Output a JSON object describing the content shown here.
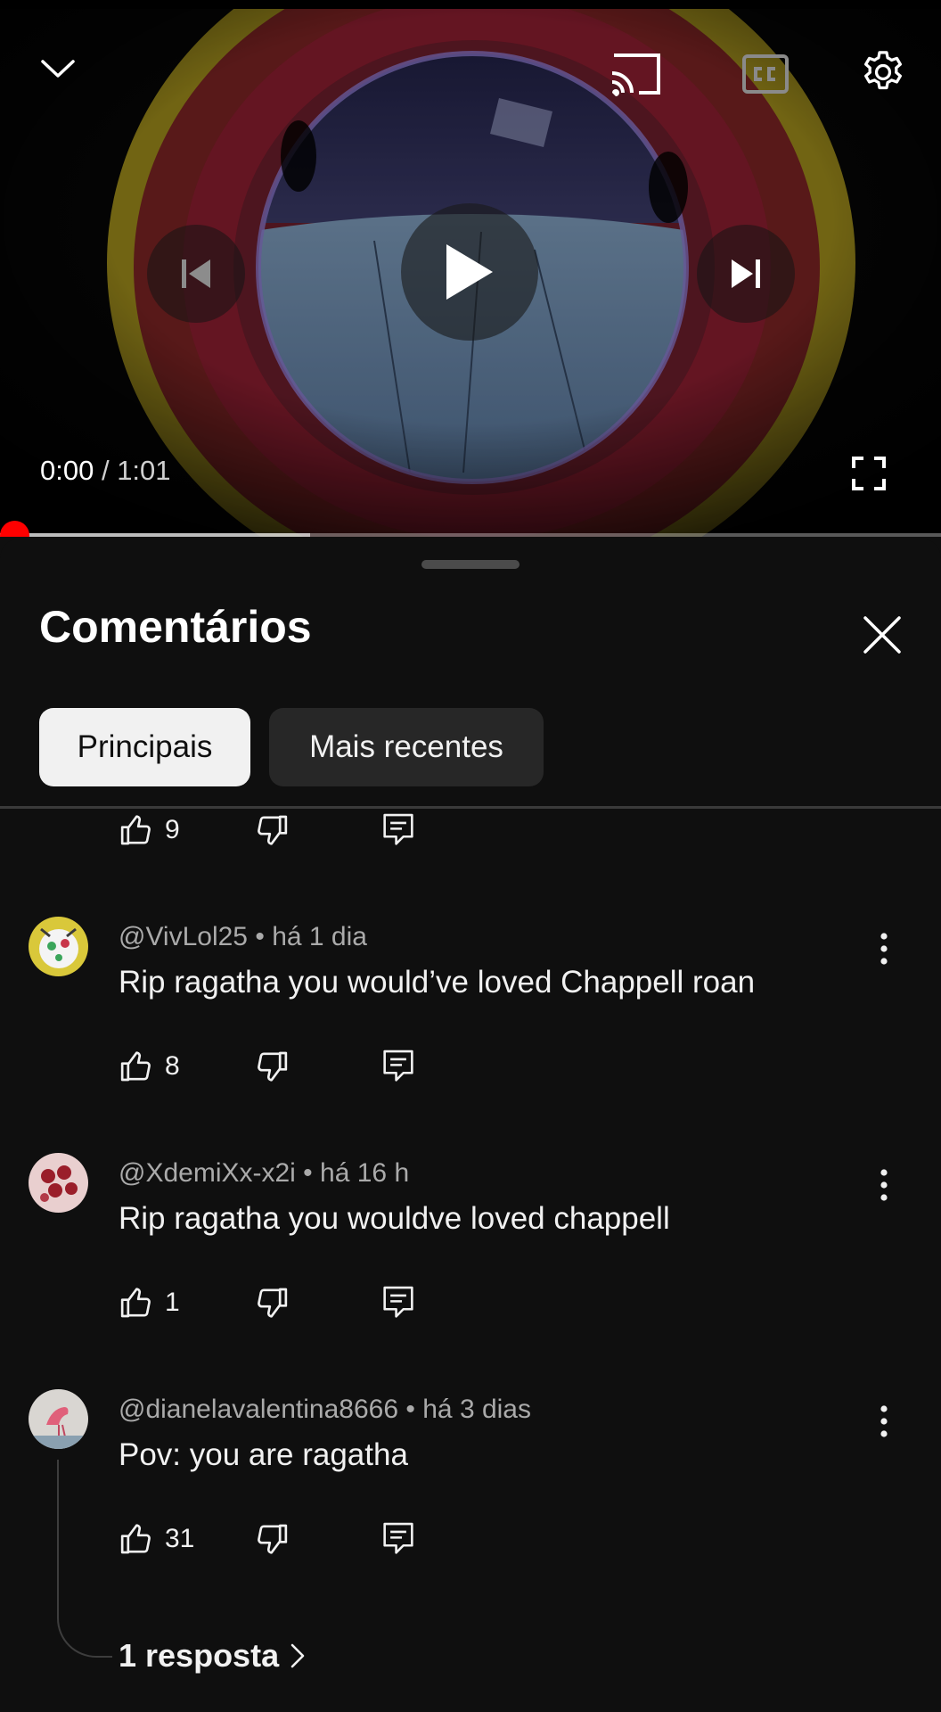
{
  "player": {
    "current_time": "0:00",
    "separator": " / ",
    "duration": "1:01",
    "played_fraction": 0.0,
    "buffered_fraction": 0.33
  },
  "comments_panel": {
    "title": "Comentários",
    "chips": [
      {
        "label": "Principais",
        "selected": true
      },
      {
        "label": "Mais recentes",
        "selected": false
      }
    ]
  },
  "partial_comment": {
    "likes": "9"
  },
  "comments": [
    {
      "author": "@VivLol25",
      "time": "há 1 dia",
      "text": "Rip ragatha you would’ve loved Chappell roan",
      "likes": "8"
    },
    {
      "author": "@XdemiXx-x2i",
      "time": "há 16 h",
      "text": "Rip ragatha you wouldve loved chappell",
      "likes": "1"
    },
    {
      "author": "@dianelavalentina8666",
      "time": "há 3 dias",
      "text": "Pov: you are ragatha",
      "likes": "31",
      "replies_label": "1 resposta"
    }
  ],
  "meta_separator": " • ",
  "colors": {
    "background": "#0f0f0f",
    "progress_red": "#ff0000",
    "chip_active": "#f1f1f1",
    "chip_inactive": "#272727",
    "meta_text": "#aaaaaa"
  }
}
